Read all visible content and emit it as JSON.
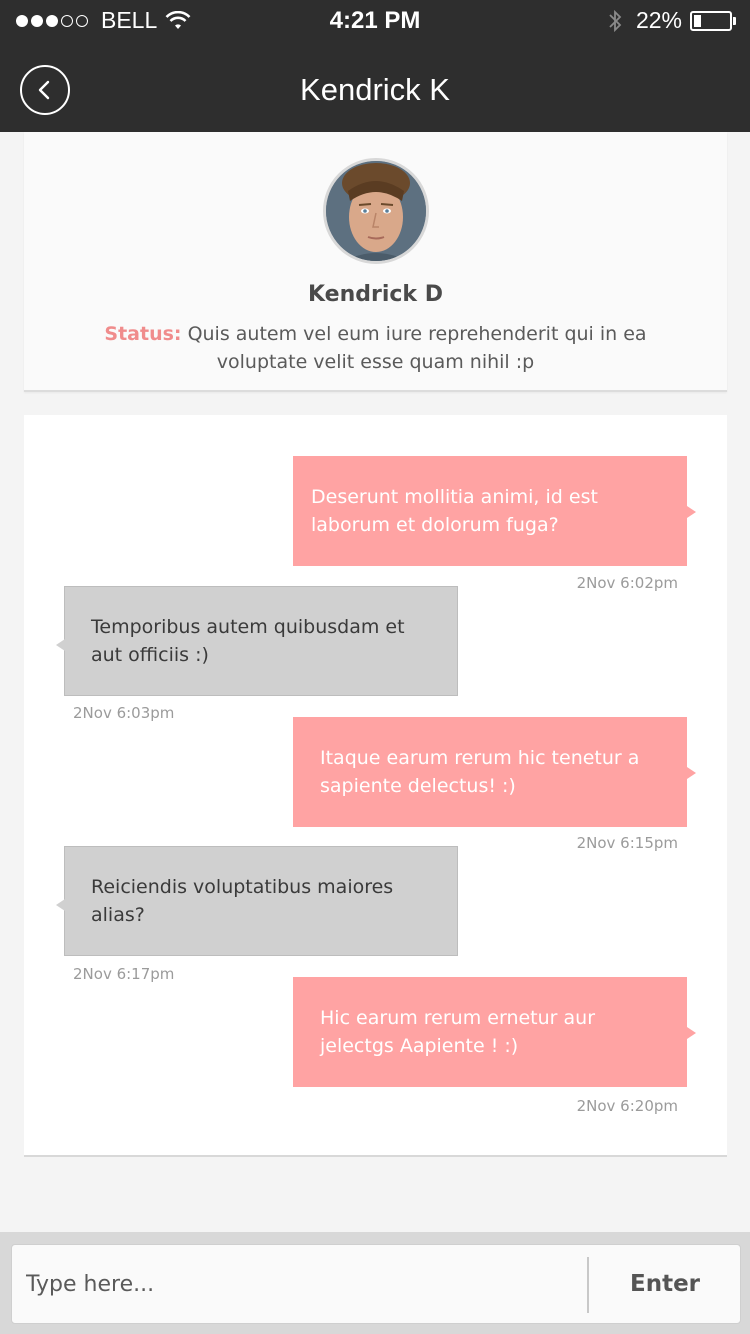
{
  "status_bar": {
    "carrier": "BELL",
    "time": "4:21 PM",
    "battery_percent_label": "22%",
    "battery_level": 0.22,
    "signal_bars_filled": 3,
    "signal_bars_total": 5
  },
  "nav": {
    "title": "Kendrick K",
    "back_icon": "chevron-left-icon"
  },
  "profile": {
    "name": "Kendrick D",
    "status_label": "Status:",
    "status_text": "Quis autem vel eum iure reprehenderit qui in ea voluptate velit esse quam nihil :p"
  },
  "messages": [
    {
      "direction": "out",
      "text": "Deserunt mollitia animi, id est laborum et dolorum fuga?",
      "timestamp": "2Nov 6:02pm"
    },
    {
      "direction": "in",
      "text": "Temporibus autem quibusdam et aut officiis :)",
      "timestamp": "2Nov 6:03pm"
    },
    {
      "direction": "out",
      "text": "Itaque earum rerum hic tenetur a sapiente delectus! :)",
      "timestamp": "2Nov 6:15pm"
    },
    {
      "direction": "in",
      "text": "Reiciendis voluptatibus maiores alias?",
      "timestamp": "2Nov 6:17pm"
    },
    {
      "direction": "out",
      "text": "Hic earum rerum ernetur aur jelectgs Aapiente ! :)",
      "timestamp": "2Nov 6:20pm"
    }
  ],
  "composer": {
    "placeholder": "Type here...",
    "value": "",
    "enter_label": "Enter"
  },
  "colors": {
    "bar_bg": "#2e2e2e",
    "outgoing_bubble": "#ffa3a3",
    "incoming_bubble": "#d0d0d0",
    "status_accent": "#f08c8c"
  }
}
